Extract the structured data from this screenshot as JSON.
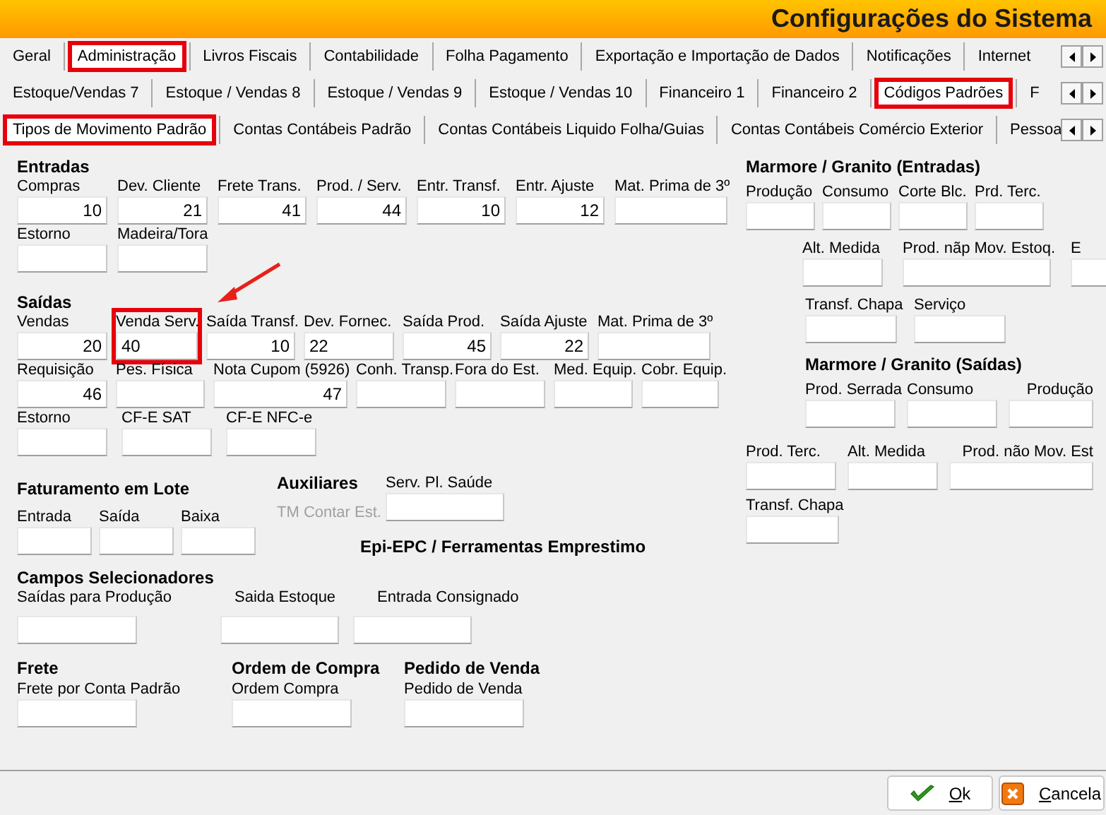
{
  "window": {
    "title": "Configurações do Sistema"
  },
  "tab_rows": [
    {
      "tabs": [
        {
          "label": "Geral",
          "selected": false,
          "highlighted": false
        },
        {
          "label": "Administração",
          "selected": true,
          "highlighted": true
        },
        {
          "label": "Livros Fiscais",
          "selected": false,
          "highlighted": false
        },
        {
          "label": "Contabilidade",
          "selected": false,
          "highlighted": false
        },
        {
          "label": "Folha Pagamento",
          "selected": false,
          "highlighted": false
        },
        {
          "label": "Exportação e Importação de Dados",
          "selected": false,
          "highlighted": false
        },
        {
          "label": "Notificações",
          "selected": false,
          "highlighted": false
        },
        {
          "label": "Internet",
          "selected": false,
          "highlighted": false
        }
      ]
    },
    {
      "tabs": [
        {
          "label": "Estoque/Vendas 7",
          "selected": false,
          "highlighted": false
        },
        {
          "label": "Estoque / Vendas 8",
          "selected": false,
          "highlighted": false
        },
        {
          "label": "Estoque / Vendas 9",
          "selected": false,
          "highlighted": false
        },
        {
          "label": "Estoque / Vendas 10",
          "selected": false,
          "highlighted": false
        },
        {
          "label": "Financeiro 1",
          "selected": false,
          "highlighted": false
        },
        {
          "label": "Financeiro 2",
          "selected": false,
          "highlighted": false
        },
        {
          "label": "Códigos Padrões",
          "selected": true,
          "highlighted": true
        },
        {
          "label": "F",
          "selected": false,
          "highlighted": false
        }
      ]
    },
    {
      "tabs": [
        {
          "label": "Tipos de Movimento Padrão",
          "selected": true,
          "highlighted": true
        },
        {
          "label": "Contas Contábeis Padrão",
          "selected": false,
          "highlighted": false
        },
        {
          "label": "Contas Contábeis Liquido Folha/Guias",
          "selected": false,
          "highlighted": false
        },
        {
          "label": "Contas Contábeis Comércio Exterior",
          "selected": false,
          "highlighted": false
        },
        {
          "label": "Pessoa",
          "selected": false,
          "highlighted": false
        }
      ]
    }
  ],
  "entradas": {
    "title": "Entradas",
    "rows": [
      [
        {
          "label": "Compras",
          "value": "10"
        },
        {
          "label": "Dev. Cliente",
          "value": "21"
        },
        {
          "label": "Frete Trans.",
          "value": "41"
        },
        {
          "label": "Prod. / Serv.",
          "value": "44"
        },
        {
          "label": "Entr. Transf.",
          "value": "10"
        },
        {
          "label": "Entr. Ajuste",
          "value": "12"
        },
        {
          "label": "Mat. Prima de 3º"
        }
      ],
      [
        {
          "label": "Estorno"
        },
        {
          "label": "Madeira/Tora"
        }
      ]
    ]
  },
  "saidas": {
    "title": "Saídas",
    "rows": [
      [
        {
          "label": "Vendas",
          "value": "20"
        },
        {
          "label": "Venda Serv.",
          "value": "40",
          "highlighted": true
        },
        {
          "label": "Saída Transf.",
          "value": "10"
        },
        {
          "label": "Dev. Fornec.",
          "value": "22"
        },
        {
          "label": "Saída Prod.",
          "value": "45"
        },
        {
          "label": "Saída Ajuste",
          "value": "22"
        },
        {
          "label": "Mat. Prima de 3º"
        }
      ],
      [
        {
          "label": "Requisição",
          "value": "46"
        },
        {
          "label": "Pes. Física"
        },
        {
          "label": "Nota Cupom (5926)",
          "value": "47"
        },
        {
          "label": "Conh. Transp."
        },
        {
          "label": "Fora do Est."
        },
        {
          "label": "Med. Equip."
        },
        {
          "label": "Cobr. Equip."
        }
      ],
      [
        {
          "label": "Estorno"
        },
        {
          "label": "CF-E SAT"
        },
        {
          "label": "CF-E NFC-e"
        }
      ]
    ]
  },
  "faturamento_em_lote": {
    "title": "Faturamento em Lote",
    "fields": [
      {
        "label": "Entrada"
      },
      {
        "label": "Saída"
      },
      {
        "label": "Baixa"
      }
    ]
  },
  "auxiliares": {
    "title": "Auxiliares",
    "note": {
      "text": "TM Contar Est.",
      "disabled": true
    },
    "field": {
      "label": "Serv. Pl. Saúde"
    }
  },
  "epi_epc": {
    "title": "Epi-EPC / Ferramentas Emprestimo"
  },
  "campos_selecionadores": {
    "title": "Campos Selecionadores",
    "fields": [
      {
        "label": "Saídas para Produção"
      },
      {
        "label": "Saida Estoque"
      },
      {
        "label": "Entrada Consignado"
      }
    ]
  },
  "bottom_groups": [
    {
      "title": "Frete",
      "field": {
        "label": "Frete por Conta Padrão"
      }
    },
    {
      "title": "Ordem de Compra",
      "field": {
        "label": "Ordem Compra"
      }
    },
    {
      "title": "Pedido de Venda",
      "field": {
        "label": "Pedido de Venda"
      }
    }
  ],
  "marmore_entradas": {
    "title": "Marmore / Granito (Entradas)",
    "rows": [
      {
        "fields": [
          {
            "label": "Produção"
          },
          {
            "label": "Consumo"
          },
          {
            "label": "Corte Blc."
          },
          {
            "label": "Prd. Terc."
          }
        ]
      },
      {
        "fields": [
          {
            "label": "Alt. Medida"
          },
          {
            "label": "Prod. nãp Mov. Estoq."
          },
          {
            "label": "E"
          }
        ]
      },
      {
        "fields": [
          {
            "label": "Transf. Chapa"
          },
          {
            "label": "Serviço"
          }
        ]
      }
    ]
  },
  "marmore_saidas": {
    "title": "Marmore / Granito (Saídas)",
    "rows": [
      {
        "fields": [
          {
            "label": "Prod. Serrada"
          },
          {
            "label": "Consumo"
          },
          {
            "label": "Produção"
          }
        ]
      },
      {
        "fields": [
          {
            "label": "Prod. Terc."
          },
          {
            "label": "Alt. Medida"
          },
          {
            "label": "Prod. não Mov. Est"
          }
        ]
      },
      {
        "fields": [
          {
            "label": "Transf. Chapa"
          }
        ]
      }
    ]
  },
  "buttons": [
    {
      "kind": "ok",
      "label": "Ok"
    },
    {
      "kind": "cancel",
      "label": "Cancela"
    }
  ]
}
